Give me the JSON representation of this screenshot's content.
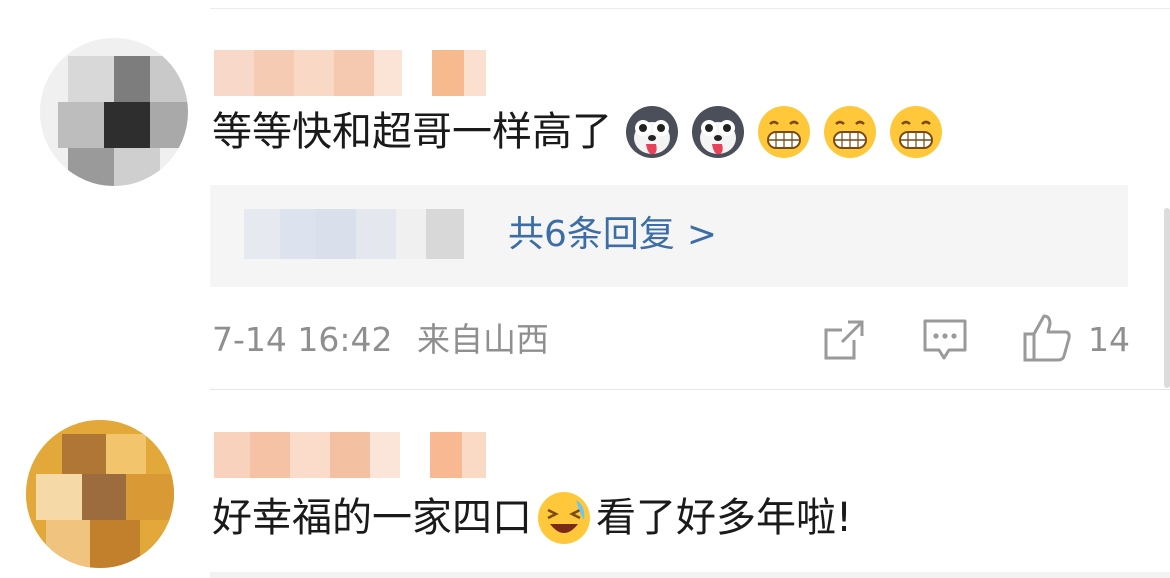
{
  "comments": [
    {
      "text": "等等快和超哥一样高了",
      "emojis": [
        "husky-emoji",
        "husky-emoji",
        "grin-emoji",
        "grin-emoji",
        "grin-emoji"
      ],
      "replies": {
        "link_text": "共6条回复"
      },
      "meta": {
        "time": "7-14 16:42",
        "location": "来自山西"
      },
      "actions": {
        "like_count": "14"
      }
    },
    {
      "text_before": "好幸福的一家四口",
      "emoji": "laugh-cry-emoji",
      "text_after": "看了好多年啦!"
    }
  ],
  "colors": {
    "link": "#3c6ea5",
    "meta": "#8f8f8f",
    "reply_bg": "#f5f5f5"
  }
}
